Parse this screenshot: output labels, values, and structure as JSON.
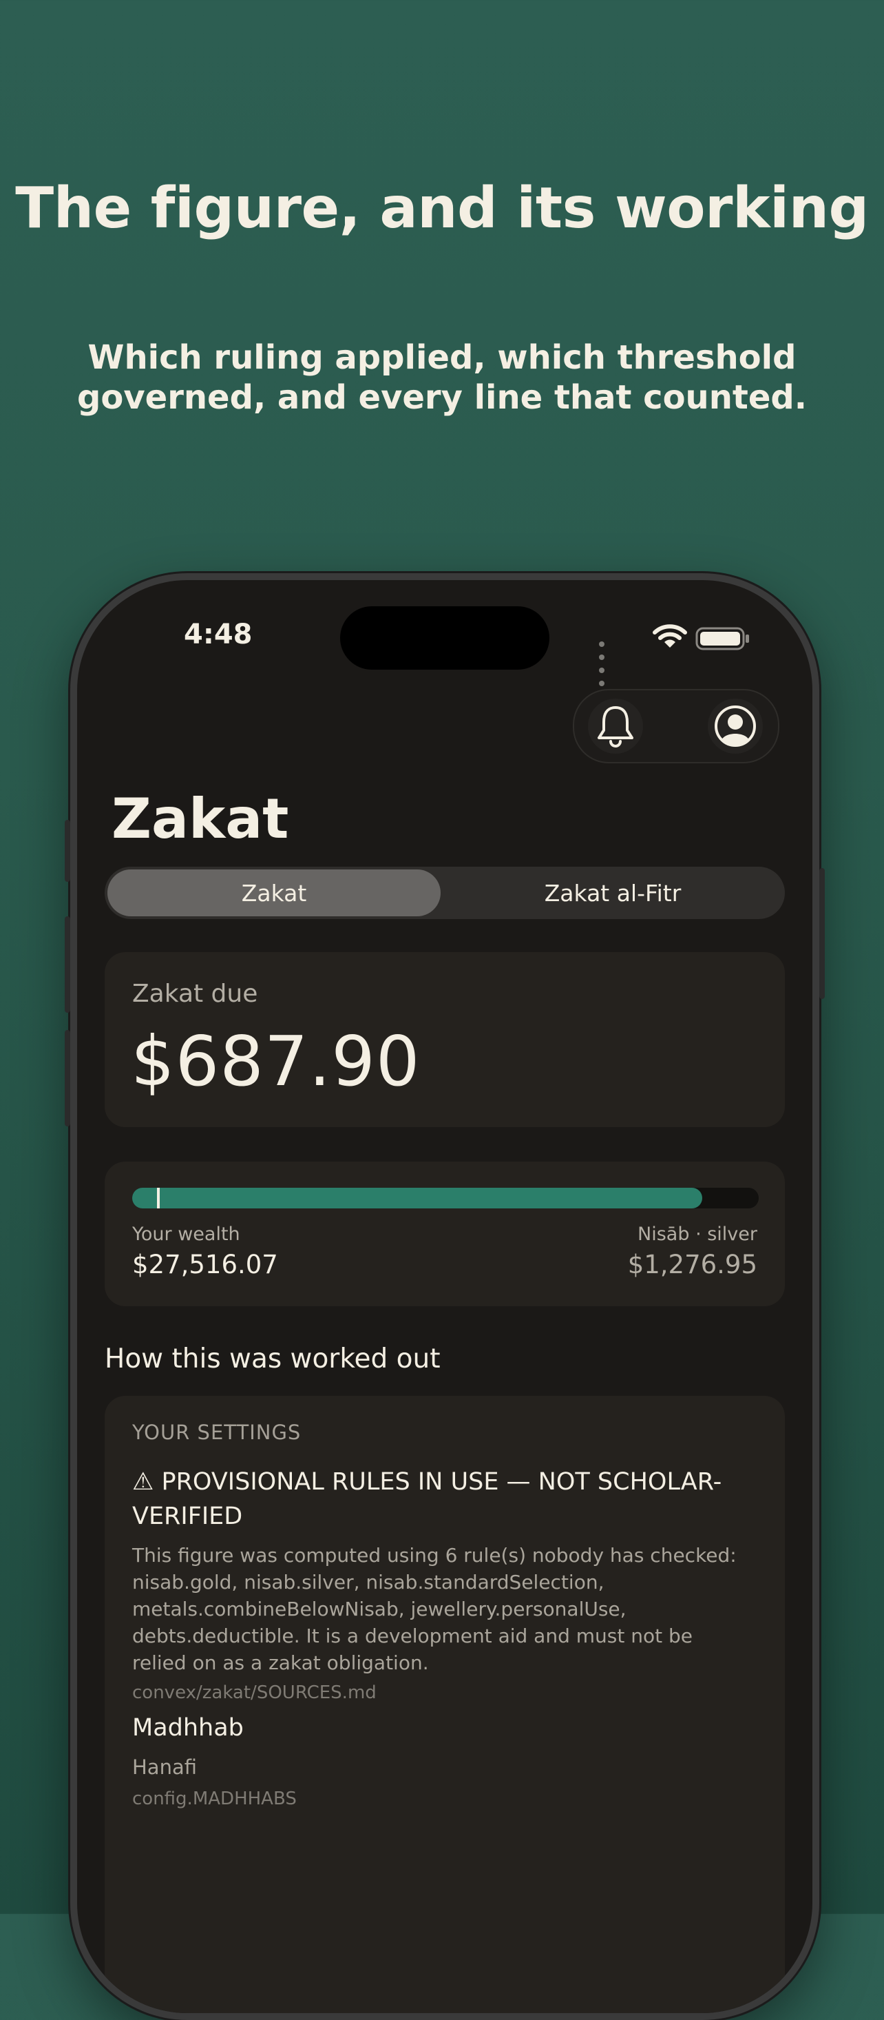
{
  "marketing": {
    "headline": "The figure, and its working",
    "subline": "Which ruling applied, which threshold governed, and every line that counted."
  },
  "status_bar": {
    "time": "4:48"
  },
  "header": {
    "bell_icon": "bell-icon",
    "profile_icon": "profile-icon"
  },
  "page": {
    "title": "Zakat"
  },
  "tabs": [
    {
      "label": "Zakat",
      "active": true
    },
    {
      "label": "Zakat al-Fitr",
      "active": false
    }
  ],
  "due": {
    "label": "Zakat due",
    "amount": "$687.90"
  },
  "nisab": {
    "wealth_label": "Your wealth",
    "wealth_value": "$27,516.07",
    "nisab_label": "Nisāb · silver",
    "nisab_value": "$1,276.95",
    "fill_fraction": 0.91,
    "marker_fraction": 0.04
  },
  "working": {
    "heading": "How this was worked out",
    "settings_heading": "YOUR SETTINGS",
    "warning_title": "⚠ PROVISIONAL RULES IN USE — NOT SCHOLAR-VERIFIED",
    "warning_body": "This figure was computed using 6 rule(s) nobody has checked: nisab.gold, nisab.silver, nisab.standardSelection, metals.combineBelowNisab, jewellery.personalUse, debts.deductible. It is a development aid and must not be relied on as a zakat obligation.",
    "warning_source": "convex/zakat/SOURCES.md",
    "madhhab_label": "Madhhab",
    "madhhab_value": "Hanafi",
    "madhhab_source": "config.MADHHABS"
  },
  "colors": {
    "background": "#2d5e52",
    "accent": "#2b7f6a",
    "screen": "#1b1917",
    "card": "#25221e",
    "text": "#f4efe3"
  }
}
